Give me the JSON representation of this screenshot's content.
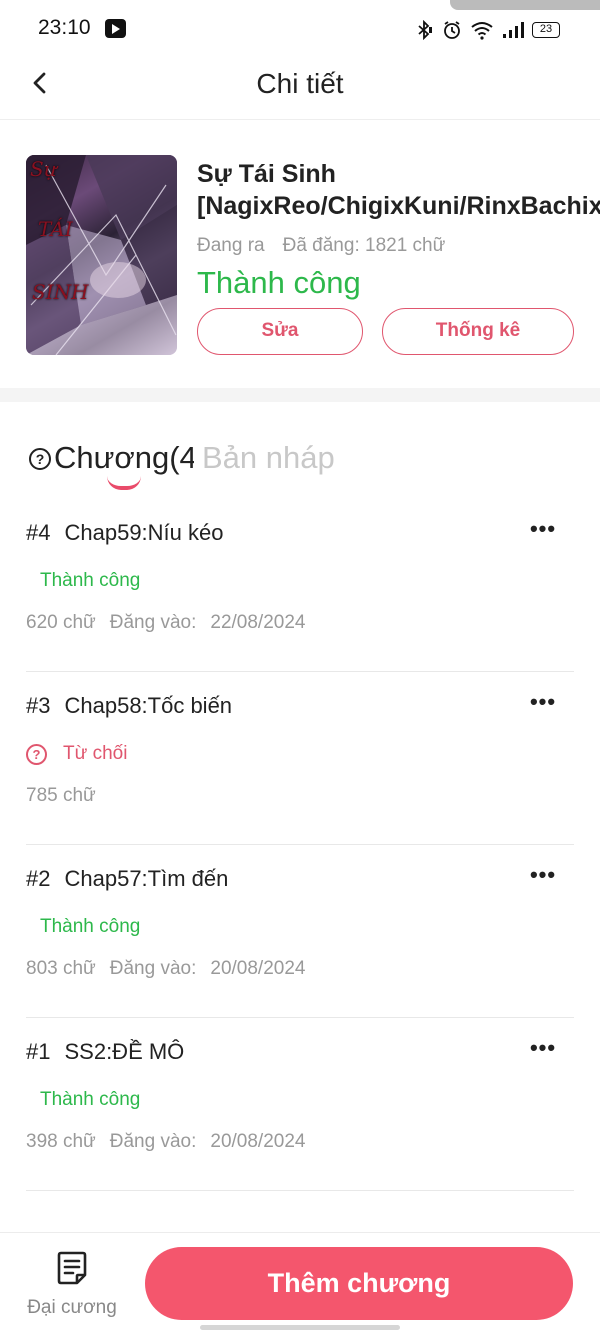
{
  "status_bar": {
    "time": "23:10",
    "battery": "23",
    "icons": [
      "bluetooth-icon",
      "alarm-icon",
      "wifi-icon",
      "signal-icon",
      "battery-icon"
    ]
  },
  "header": {
    "title": "Chi tiết"
  },
  "book": {
    "title": "Sự Tái Sinh [NagixReo/ChigixKuni/RinxBachix...",
    "state": "Đang ra",
    "posted": "Đã đăng: 1821 chữ",
    "status": "Thành công",
    "cover_text": [
      "Sự",
      "TÁI",
      "SINH"
    ],
    "edit_label": "Sửa",
    "stats_label": "Thống kê"
  },
  "tabs": {
    "chapters": "Chương(4)",
    "drafts": "Bản nháp"
  },
  "chapters": [
    {
      "num": "#4",
      "title": "Chap59:Níu kéo",
      "status": "Thành công",
      "words": "620 chữ",
      "posted_label": "Đăng vào:",
      "date": "22/08/2024"
    },
    {
      "num": "#3",
      "title": "Chap58:Tốc biến",
      "status": "Từ chối",
      "words": "785 chữ"
    },
    {
      "num": "#2",
      "title": "Chap57:Tìm đến",
      "status": "Thành công",
      "words": "803 chữ",
      "posted_label": "Đăng vào:",
      "date": "20/08/2024"
    },
    {
      "num": "#1",
      "title": "SS2:ĐỀ MÔ",
      "status": "Thành công",
      "words": "398 chữ",
      "posted_label": "Đăng vào:",
      "date": "20/08/2024"
    }
  ],
  "more_glyph": "•••",
  "bottom": {
    "outline_label": "Đại cương",
    "add_label": "Thêm chương"
  },
  "colors": {
    "accent": "#f4566d",
    "success": "#2db84b",
    "reject": "#e0566e"
  }
}
